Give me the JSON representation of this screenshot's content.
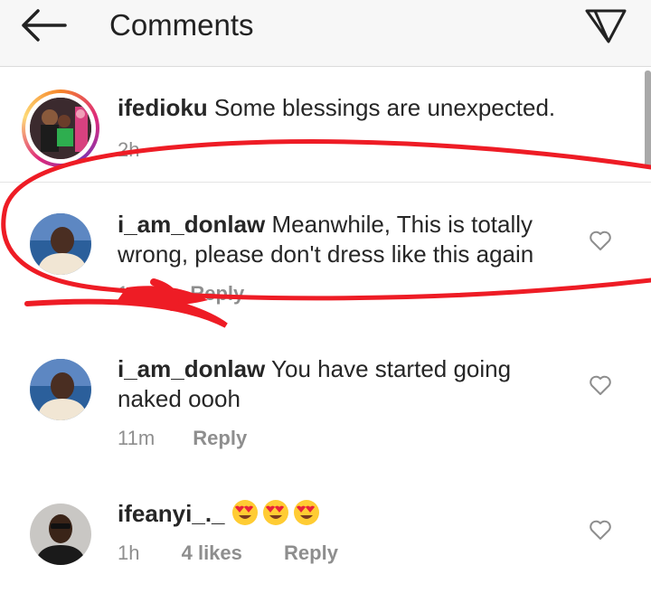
{
  "header": {
    "title": "Comments",
    "back_icon": "arrow-left-icon",
    "send_icon": "paper-plane-icon"
  },
  "comments": [
    {
      "username": "ifedioku",
      "text": "Some blessings are unexpected.",
      "time": "2h",
      "has_story_ring": true
    },
    {
      "username": "i_am_donlaw",
      "text_line1": "Meanwhile, This is totally",
      "text_line2": "wrong, please don't dress like this again",
      "time": "1",
      "reply": "Reply"
    },
    {
      "username": "i_am_donlaw",
      "text_line1": "You have started going",
      "text_line2": "naked oooh",
      "time": "11m",
      "reply": "Reply"
    },
    {
      "username": "ifeanyi_._",
      "emojis": [
        "heart-eyes-emoji",
        "heart-eyes-emoji",
        "heart-eyes-emoji"
      ],
      "time": "1h",
      "likes": "4 likes",
      "reply": "Reply"
    }
  ],
  "colors": {
    "annotation_red": "#ee1c25",
    "story_ring": "#dd2a7b",
    "meta_gray": "#8e8e8e"
  }
}
